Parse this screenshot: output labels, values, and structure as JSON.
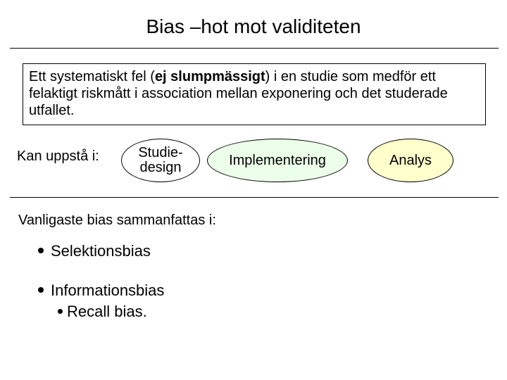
{
  "title": "Bias –hot mot validiteten",
  "definition": {
    "pre": "Ett systematiskt fel (",
    "emph": "ej slumpmässigt",
    "post": ") i en studie som medför ett felaktigt riskmått i association mellan exponering och det studerade utfallet."
  },
  "occurs_lead": "Kan uppstå i:",
  "ellipses": {
    "design_l1": "Studie-",
    "design_l2": "design",
    "implementation": "Implementering",
    "analysis": "Analys"
  },
  "summary_lead": "Vanligaste bias sammanfattas i:",
  "bullets": {
    "b1": "Selektionsbias",
    "b2": "Informationsbias",
    "b2a": "Recall bias."
  }
}
